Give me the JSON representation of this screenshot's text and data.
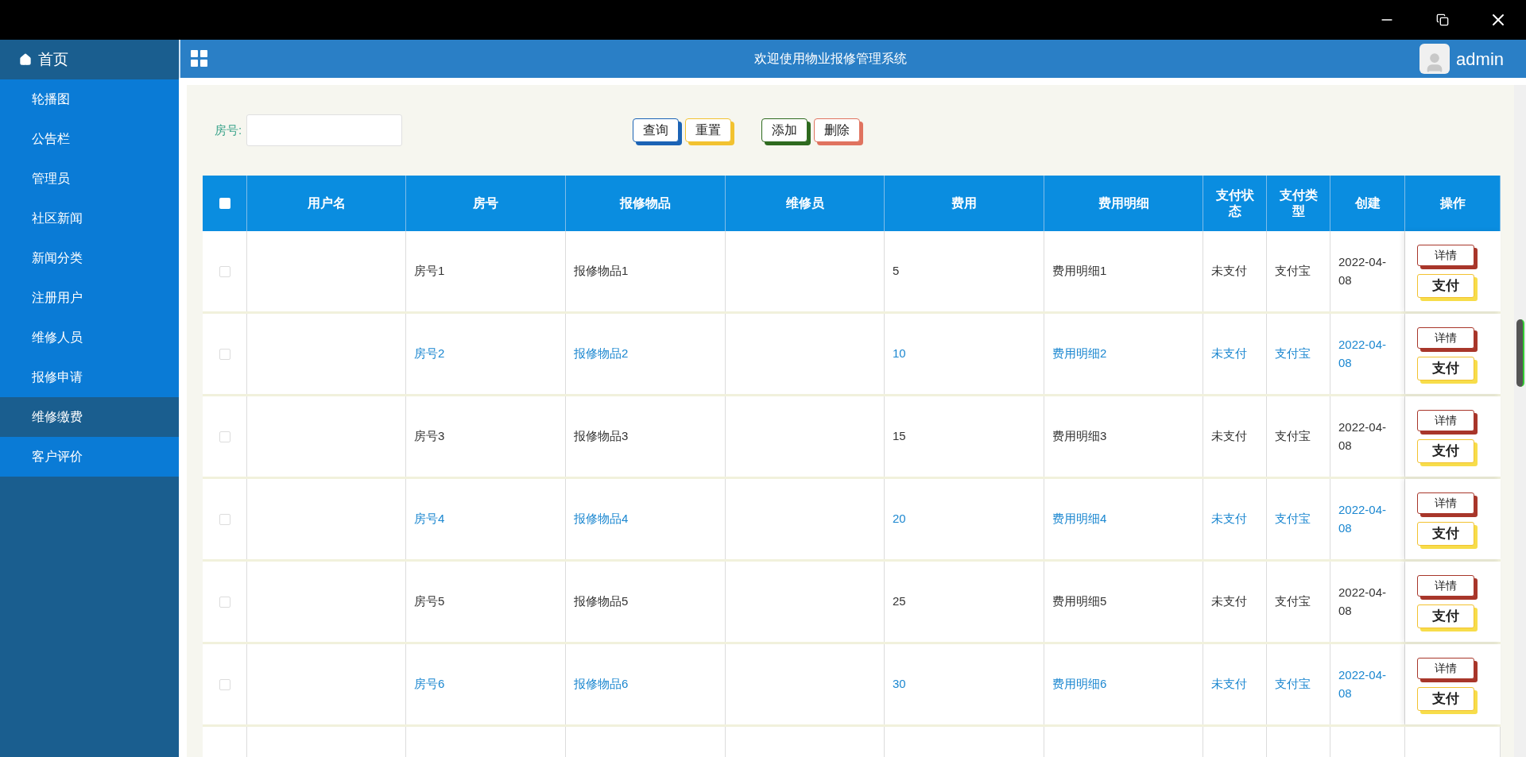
{
  "sidebar": {
    "home": "首页",
    "items": [
      {
        "label": "轮播图",
        "selected": false
      },
      {
        "label": "公告栏",
        "selected": false
      },
      {
        "label": "管理员",
        "selected": false
      },
      {
        "label": "社区新闻",
        "selected": false
      },
      {
        "label": "新闻分类",
        "selected": false
      },
      {
        "label": "注册用户",
        "selected": false
      },
      {
        "label": "维修人员",
        "selected": false
      },
      {
        "label": "报修申请",
        "selected": false
      },
      {
        "label": "维修缴费",
        "selected": true
      },
      {
        "label": "客户评价",
        "selected": false
      }
    ]
  },
  "header": {
    "title": "欢迎使用物业报修管理系统",
    "user": "admin"
  },
  "search": {
    "label": "房号:"
  },
  "buttons": [
    {
      "label": "查询",
      "color": "#1b63b5"
    },
    {
      "label": "重置",
      "color": "#f2c230"
    },
    {
      "label": "添加",
      "color": "#2e6a1f"
    },
    {
      "label": "删除",
      "color": "#e0735f"
    }
  ],
  "table": {
    "select_all": {
      "checked": false
    },
    "columns": [
      "用户名",
      "房号",
      "报修物品",
      "维修员",
      "费用",
      "费用明细",
      "支付状态",
      "支付类型",
      "创建",
      "操作"
    ],
    "rows": [
      {
        "checked": false,
        "highlighted": false,
        "room": "房号1",
        "item": "报修物品1",
        "fee": "5",
        "fee_detail": "费用明细1",
        "pay_status": "未支付",
        "pay_type": "支付宝",
        "created": "2022-04-08",
        "actions": [
          "详情",
          "支付"
        ]
      },
      {
        "checked": false,
        "highlighted": true,
        "room": "房号2",
        "item": "报修物品2",
        "fee": "10",
        "fee_detail": "费用明细2",
        "pay_status": "未支付",
        "pay_type": "支付宝",
        "created": "2022-04-08",
        "actions": [
          "详情",
          "支付"
        ]
      },
      {
        "checked": false,
        "highlighted": false,
        "room": "房号3",
        "item": "报修物品3",
        "fee": "15",
        "fee_detail": "费用明细3",
        "pay_status": "未支付",
        "pay_type": "支付宝",
        "created": "2022-04-08",
        "actions": [
          "详情",
          "支付"
        ]
      },
      {
        "checked": false,
        "highlighted": true,
        "room": "房号4",
        "item": "报修物品4",
        "fee": "20",
        "fee_detail": "费用明细4",
        "pay_status": "未支付",
        "pay_type": "支付宝",
        "created": "2022-04-08",
        "actions": [
          "详情",
          "支付"
        ]
      },
      {
        "checked": false,
        "highlighted": false,
        "room": "房号5",
        "item": "报修物品5",
        "fee": "25",
        "fee_detail": "费用明细5",
        "pay_status": "未支付",
        "pay_type": "支付宝",
        "created": "2022-04-08",
        "actions": [
          "详情",
          "支付"
        ]
      },
      {
        "checked": false,
        "highlighted": true,
        "room": "房号6",
        "item": "报修物品6",
        "fee": "30",
        "fee_detail": "费用明细6",
        "pay_status": "未支付",
        "pay_type": "支付宝",
        "created": "2022-04-08",
        "actions": [
          "详情",
          "支付"
        ]
      }
    ]
  }
}
